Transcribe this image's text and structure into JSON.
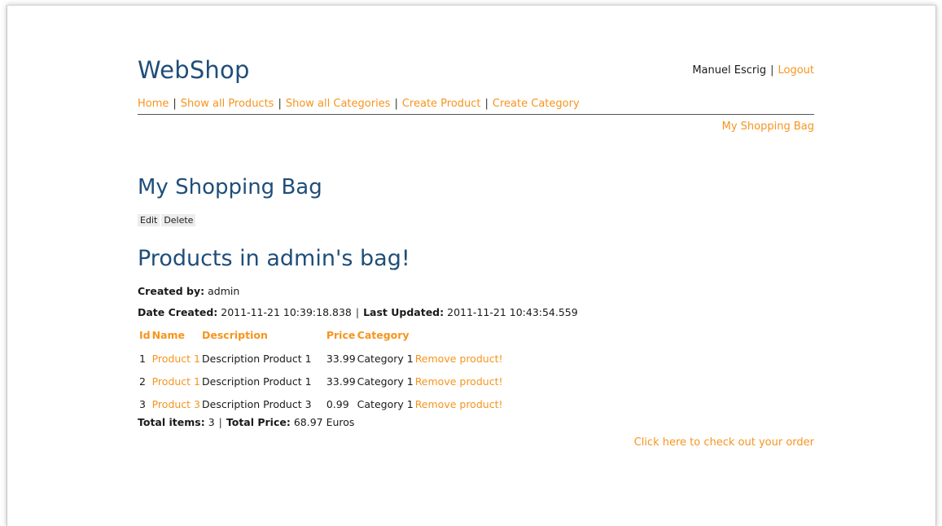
{
  "header": {
    "brand": "WebShop",
    "user_name": "Manuel Escrig",
    "logout_label": "Logout",
    "separator": "|"
  },
  "nav": {
    "items": [
      {
        "label": "Home"
      },
      {
        "label": "Show all Products"
      },
      {
        "label": "Show all Categories"
      },
      {
        "label": "Create Product"
      },
      {
        "label": "Create Category"
      }
    ],
    "bag_link": "My Shopping Bag"
  },
  "page": {
    "title": "My Shopping Bag",
    "edit_label": "Edit",
    "delete_label": "Delete",
    "subtitle": "Products in admin's bag!",
    "created_by_label": "Created by:",
    "created_by_value": "admin",
    "date_created_label": "Date Created:",
    "date_created_value": "2011-11-21 10:39:18.838",
    "last_updated_label": "Last Updated:",
    "last_updated_value": "2011-11-21 10:43:54.559"
  },
  "table": {
    "headers": [
      "Id",
      "Name",
      "Description",
      "Price",
      "Category",
      ""
    ],
    "rows": [
      {
        "id": "1",
        "name": "Product 1",
        "description": "Description Product 1",
        "price": "33.99",
        "category": "Category 1",
        "action": "Remove product!"
      },
      {
        "id": "2",
        "name": "Product 1",
        "description": "Description Product 1",
        "price": "33.99",
        "category": "Category 1",
        "action": "Remove product!"
      },
      {
        "id": "3",
        "name": "Product 3",
        "description": "Description Product 3",
        "price": "0.99",
        "category": "Category 1",
        "action": "Remove product!"
      }
    ]
  },
  "totals": {
    "items_label": "Total items:",
    "items_value": "3",
    "price_label": "Total Price:",
    "price_value": "68.97 Euros"
  },
  "checkout_label": "Click here to check out your order",
  "colors": {
    "link": "#f7941d",
    "heading": "#1f4e79"
  }
}
